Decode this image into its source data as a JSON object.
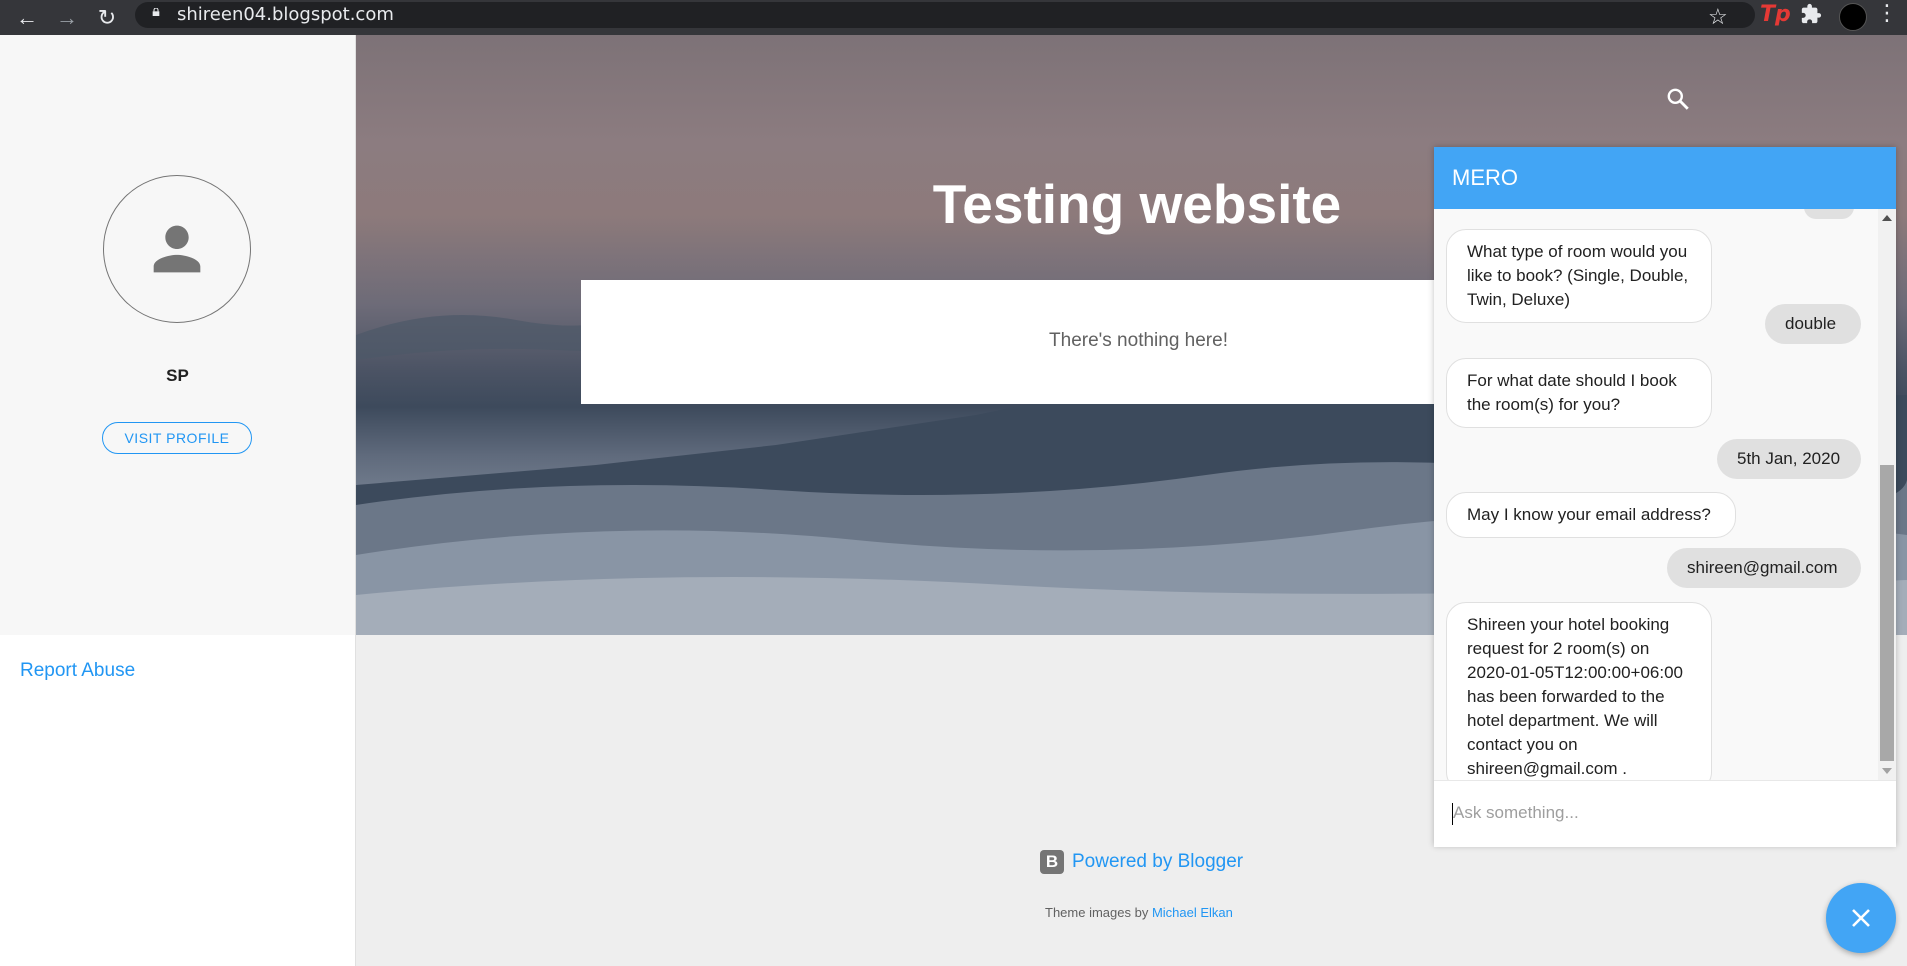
{
  "browser": {
    "url": "shireen04.blogspot.com",
    "icons": [
      "back-icon",
      "forward-icon",
      "reload-icon",
      "lock-icon",
      "star-icon",
      "tp-extension-icon",
      "puzzle-icon",
      "profile-icon",
      "kebab-menu-icon"
    ],
    "tp_label": "Tp"
  },
  "sidebar": {
    "profile_name": "SP",
    "visit_profile": "VISIT PROFILE",
    "report_abuse": "Report Abuse"
  },
  "main": {
    "title": "Testing website",
    "empty_message": "There's nothing here!"
  },
  "footer": {
    "powered_by": "Powered by Blogger",
    "theme_prefix": "Theme images by",
    "theme_author": "Michael Elkan"
  },
  "chat": {
    "bot_name": "MERO",
    "messages": [
      {
        "from": "bot",
        "text": "What type of room would you like to book? (Single, Double, Twin, Deluxe)"
      },
      {
        "from": "user",
        "text": "double"
      },
      {
        "from": "bot",
        "text": "For what date should I book the room(s) for you?"
      },
      {
        "from": "user",
        "text": "5th Jan, 2020"
      },
      {
        "from": "bot",
        "text": "May I know your email address?"
      },
      {
        "from": "user",
        "text": "shireen@gmail.com"
      },
      {
        "from": "bot",
        "text": "Shireen your hotel booking request for 2 room(s) on 2020-01-05T12:00:00+06:00 has been forwarded to the hotel department. We will contact you on shireen@gmail.com ."
      }
    ],
    "input_placeholder": "Ask something..."
  },
  "colors": {
    "accent": "#2196f3",
    "chat_header": "#42a5f5"
  }
}
